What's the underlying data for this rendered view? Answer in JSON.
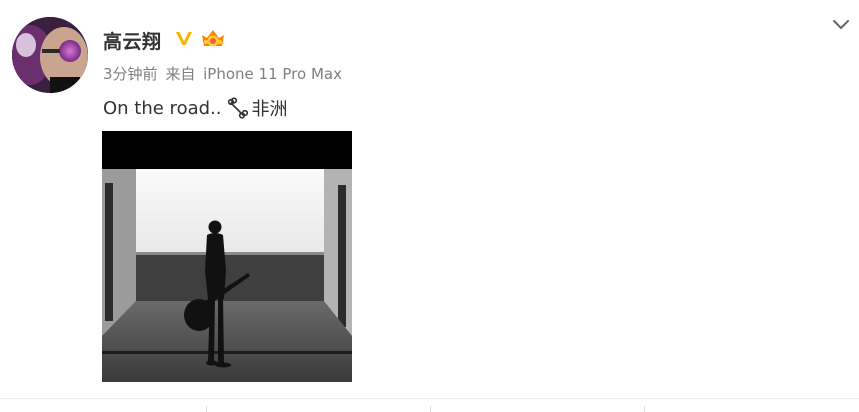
{
  "post": {
    "author": {
      "name": "高云翔"
    },
    "meta": {
      "time": "3分钟前",
      "source_prefix": "来自",
      "source": "iPhone 11 Pro Max"
    },
    "text": "On the road..",
    "location": "非洲"
  },
  "icons": {
    "verified": "verified-v-icon",
    "vip": "vip-crown-icon",
    "location": "location-link-icon",
    "menu": "chevron-down-icon"
  },
  "colors": {
    "name_text": "#333333",
    "meta_text": "#808080",
    "verified_badge": "#f4b400",
    "vip_badge": "#ff8200",
    "divider": "#f0f0f0"
  }
}
